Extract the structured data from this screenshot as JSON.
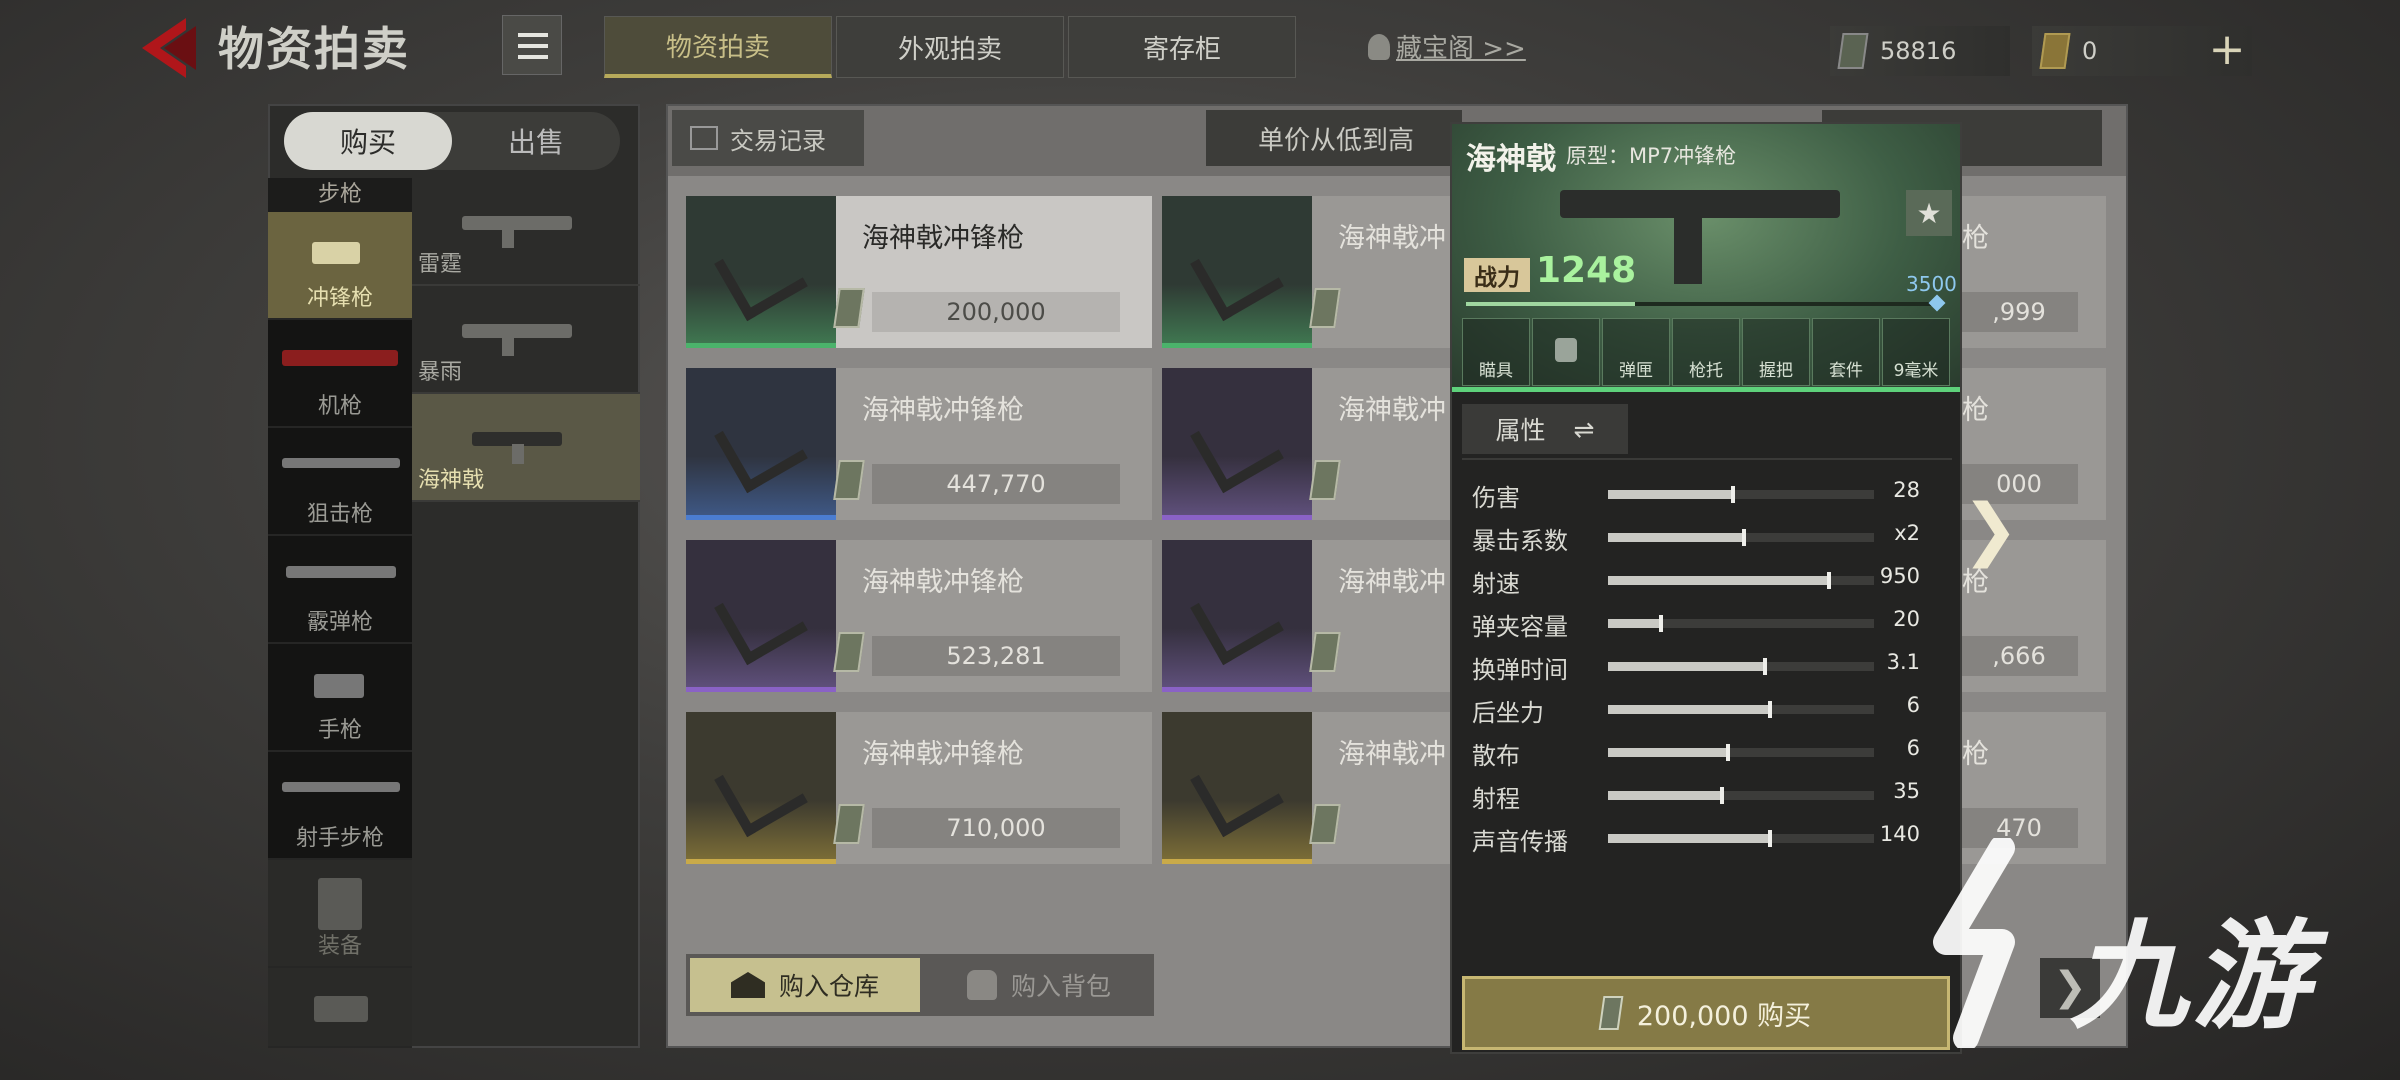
{
  "header": {
    "title": "物资拍卖",
    "tabs": [
      {
        "label": "物资拍卖",
        "active": true
      },
      {
        "label": "外观拍卖",
        "active": false
      },
      {
        "label": "寄存柜",
        "active": false
      }
    ],
    "treasure_link": "藏宝阁 >>",
    "currency_silver": "58816",
    "currency_gold": "0",
    "plus_symbol": "+"
  },
  "sidebar": {
    "toggle": {
      "buy": "购买",
      "sell": "出售"
    },
    "category_header": "步枪",
    "categories": [
      {
        "label": "冲锋枪",
        "active": true
      },
      {
        "label": "机枪"
      },
      {
        "label": "狙击枪"
      },
      {
        "label": "霰弹枪"
      },
      {
        "label": "手枪"
      },
      {
        "label": "射手步枪"
      },
      {
        "label": "装备"
      }
    ],
    "guns": [
      {
        "label": "雷霆"
      },
      {
        "label": "暴雨"
      },
      {
        "label": "海神戟",
        "active": true
      }
    ]
  },
  "main": {
    "trade_record": "交易记录",
    "sort_label": "单价从低到高",
    "items": [
      {
        "name": "海神戟冲锋枪",
        "price": "200,000",
        "rarity": "green"
      },
      {
        "name": "海神戟冲锋枪",
        "price": "447,770",
        "rarity": "blue"
      },
      {
        "name": "海神戟冲锋枪",
        "price": "523,281",
        "rarity": "purple"
      },
      {
        "name": "海神戟冲锋枪",
        "price": "710,000",
        "rarity": "gold"
      }
    ],
    "items_col2": [
      {
        "name": "海神戟冲",
        "price": "",
        "rarity": "green"
      },
      {
        "name": "海神戟冲",
        "price": "",
        "rarity": "purple"
      },
      {
        "name": "海神戟冲",
        "price": "",
        "rarity": "purple"
      },
      {
        "name": "海神戟冲",
        "price": "",
        "rarity": "gold"
      }
    ],
    "items_col3": [
      {
        "name": "枪",
        "price": ",999"
      },
      {
        "name": "枪",
        "price": "000"
      },
      {
        "name": "枪",
        "price": ",666"
      },
      {
        "name": "枪",
        "price": "470"
      }
    ],
    "buy_to_warehouse": "购入仓库",
    "buy_to_backpack": "购入背包",
    "next_arrow": "❯",
    "page_next": "❯"
  },
  "detail": {
    "name": "海神戟",
    "prototype": "原型：MP7冲锋枪",
    "power_label": "战力",
    "power_value": "1248",
    "power_max": "3500",
    "power_fraction": 0.356,
    "attachments": [
      "瞄具",
      "",
      "弹匣",
      "枪托",
      "握把",
      "套件",
      "9毫米"
    ],
    "properties_tab": "属性",
    "swap_icon": "⇌",
    "stats": [
      {
        "key": "伤害",
        "value": "28",
        "fill": 0.47
      },
      {
        "key": "暴击系数",
        "value": "x2",
        "fill": 0.51
      },
      {
        "key": "射速",
        "value": "950",
        "fill": 0.83
      },
      {
        "key": "弹夹容量",
        "value": "20",
        "fill": 0.2
      },
      {
        "key": "换弹时间",
        "value": "3.1",
        "fill": 0.59
      },
      {
        "key": "后坐力",
        "value": "6",
        "fill": 0.61
      },
      {
        "key": "散布",
        "value": "6",
        "fill": 0.45
      },
      {
        "key": "射程",
        "value": "35",
        "fill": 0.43
      },
      {
        "key": "声音传播",
        "value": "140",
        "fill": 0.61
      }
    ],
    "buy_button": "200,000 购买",
    "star_icon": "★"
  },
  "watermark": {
    "text": "九游"
  }
}
